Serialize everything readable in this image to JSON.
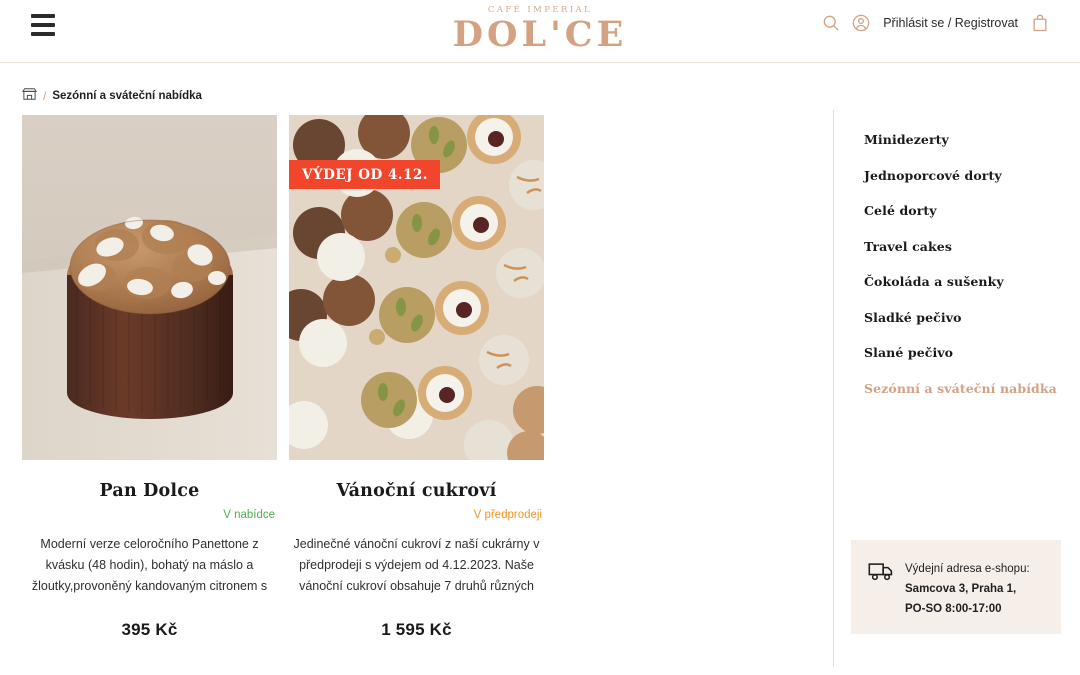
{
  "header": {
    "menu_icon": "hamburger-icon",
    "brand_sub": "CAFÉ IMPERIAL",
    "brand_main": "DOL'CE",
    "search_icon": "search-icon",
    "account_icon": "account-icon",
    "login_label": "Přihlásit se / Registrovat",
    "cart_icon": "cart-icon"
  },
  "breadcrumb": {
    "home_icon": "shop-icon",
    "separator": "/",
    "current": "Sezónní a sváteční nabídka"
  },
  "products": [
    {
      "image_alt": "panettone-photo",
      "badge": "",
      "title": "Pan Dolce",
      "status": "V nabídce",
      "status_color": "#4eb050",
      "description": "Moderní verze celoročního Panettone z kvásku (48 hodin), bohatý na máslo a žloutky,provoněný kandovaným citronem s",
      "price": "395 Kč"
    },
    {
      "image_alt": "christmas-cookies-photo",
      "badge": "VÝDEJ OD 4.12.",
      "title": "Vánoční cukroví",
      "status": "V předprodeji",
      "status_color": "#f7941e",
      "description": "Jedinečné vánoční cukroví z naší cukrárny v předprodeji s výdejem od 4.12.2023. Naše vánoční cukroví obsahuje 7 druhů různých",
      "price": "1 595 Kč"
    }
  ],
  "sidebar": {
    "items": [
      {
        "label": "Minidezerty",
        "active": false
      },
      {
        "label": "Jednoporcové dorty",
        "active": false
      },
      {
        "label": "Celé dorty",
        "active": false
      },
      {
        "label": "Travel cakes",
        "active": false
      },
      {
        "label": "Čokoláda a sušenky",
        "active": false
      },
      {
        "label": "Sladké pečivo",
        "active": false
      },
      {
        "label": "Slané pečivo",
        "active": false
      },
      {
        "label": "Sezónní a sváteční nabídka",
        "active": true
      }
    ]
  },
  "delivery": {
    "icon": "truck-icon",
    "line1": "Výdejní adresa e-shopu:",
    "line2": "Samcova 3, Praha 1,",
    "line3": "PO-SO 8:00-17:00"
  },
  "colors": {
    "brand": "#d5a183",
    "badge_red": "#f2462c",
    "status_green": "#4eb050",
    "status_orange": "#f7941e",
    "panel_bg": "#f6eee9",
    "divider": "#e8dcd2"
  }
}
